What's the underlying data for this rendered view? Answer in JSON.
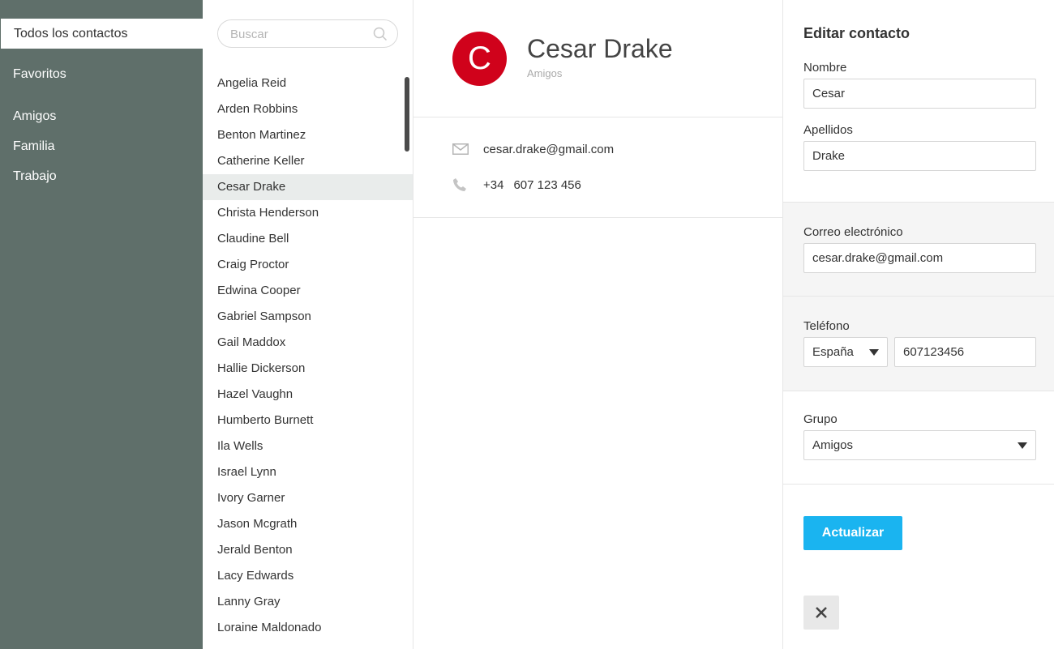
{
  "nav": {
    "items": [
      {
        "label": "Todos los contactos"
      },
      {
        "label": "Favoritos"
      },
      {
        "label": "Amigos"
      },
      {
        "label": "Familia"
      },
      {
        "label": "Trabajo"
      }
    ]
  },
  "search": {
    "placeholder": "Buscar"
  },
  "contacts": [
    "Angelia Reid",
    "Arden Robbins",
    "Benton Martinez",
    "Catherine Keller",
    "Cesar Drake",
    "Christa Henderson",
    "Claudine Bell",
    "Craig Proctor",
    "Edwina Cooper",
    "Gabriel Sampson",
    "Gail Maddox",
    "Hallie Dickerson",
    "Hazel Vaughn",
    "Humberto Burnett",
    "Ila Wells",
    "Israel Lynn",
    "Ivory Garner",
    "Jason Mcgrath",
    "Jerald Benton",
    "Lacy Edwards",
    "Lanny Gray",
    "Loraine Maldonado"
  ],
  "selected_contact": "Cesar Drake",
  "detail": {
    "avatar_letter": "C",
    "name": "Cesar Drake",
    "group": "Amigos",
    "email": "cesar.drake@gmail.com",
    "phone_prefix": "+34",
    "phone_number": "607 123 456",
    "avatar_color": "#d0021b"
  },
  "edit": {
    "title": "Editar contacto",
    "first_name_label": "Nombre",
    "first_name_value": "Cesar",
    "last_name_label": "Apellidos",
    "last_name_value": "Drake",
    "email_label": "Correo electrónico",
    "email_value": "cesar.drake@gmail.com",
    "phone_label": "Teléfono",
    "country_value": "España",
    "phone_value": "607123456",
    "group_label": "Grupo",
    "group_value": "Amigos",
    "update_label": "Actualizar",
    "update_color": "#1ab4f0"
  },
  "colors": {
    "sidebar": "#5f6f6a",
    "selected_row": "#e9eceb"
  }
}
